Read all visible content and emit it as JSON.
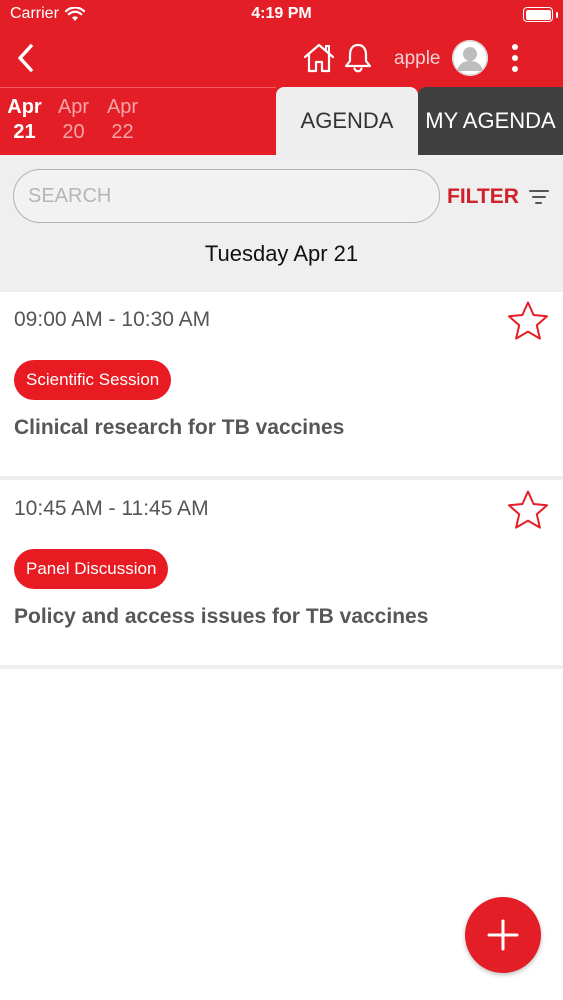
{
  "status_bar": {
    "carrier": "Carrier",
    "time": "4:19 PM",
    "wifi_icon": "wifi-icon",
    "battery_icon": "battery-icon"
  },
  "nav": {
    "back_icon": "chevron-left-icon",
    "home_icon": "home-icon",
    "bell_icon": "bell-icon",
    "username": "apple",
    "avatar_icon": "user-avatar-icon",
    "menu_icon": "more-vertical-icon"
  },
  "dates": [
    {
      "month": "Apr",
      "day": "21",
      "selected": true
    },
    {
      "month": "Apr",
      "day": "20",
      "selected": false
    },
    {
      "month": "Apr",
      "day": "22",
      "selected": false
    }
  ],
  "tabs": {
    "agenda": "AGENDA",
    "my_agenda": "MY AGENDA",
    "active": "AGENDA"
  },
  "search": {
    "placeholder": "SEARCH",
    "value": ""
  },
  "filter": {
    "label": "FILTER",
    "icon": "filter-icon"
  },
  "day_heading": "Tuesday Apr 21",
  "sessions": [
    {
      "time": "09:00 AM - 10:30 AM",
      "tag": "Scientific Session",
      "title": "Clinical research for TB vaccines",
      "favorite_icon": "star-outline-icon"
    },
    {
      "time": "10:45 AM - 11:45 AM",
      "tag": "Panel Discussion",
      "title": "Policy and access issues for TB vaccines",
      "favorite_icon": "star-outline-icon"
    }
  ],
  "fab_icon": "plus-icon",
  "colors": {
    "brand": "#e31e26",
    "tab_dark": "#404040",
    "tag_bg": "#e81b22",
    "filter_text": "#d0202a"
  }
}
